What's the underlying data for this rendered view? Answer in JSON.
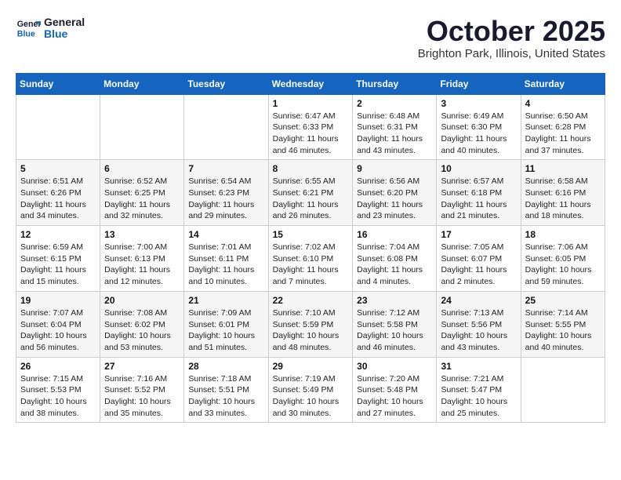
{
  "header": {
    "logo_line1": "General",
    "logo_line2": "Blue",
    "month": "October 2025",
    "location": "Brighton Park, Illinois, United States"
  },
  "weekdays": [
    "Sunday",
    "Monday",
    "Tuesday",
    "Wednesday",
    "Thursday",
    "Friday",
    "Saturday"
  ],
  "weeks": [
    [
      {
        "day": "",
        "info": ""
      },
      {
        "day": "",
        "info": ""
      },
      {
        "day": "",
        "info": ""
      },
      {
        "day": "1",
        "info": "Sunrise: 6:47 AM\nSunset: 6:33 PM\nDaylight: 11 hours\nand 46 minutes."
      },
      {
        "day": "2",
        "info": "Sunrise: 6:48 AM\nSunset: 6:31 PM\nDaylight: 11 hours\nand 43 minutes."
      },
      {
        "day": "3",
        "info": "Sunrise: 6:49 AM\nSunset: 6:30 PM\nDaylight: 11 hours\nand 40 minutes."
      },
      {
        "day": "4",
        "info": "Sunrise: 6:50 AM\nSunset: 6:28 PM\nDaylight: 11 hours\nand 37 minutes."
      }
    ],
    [
      {
        "day": "5",
        "info": "Sunrise: 6:51 AM\nSunset: 6:26 PM\nDaylight: 11 hours\nand 34 minutes."
      },
      {
        "day": "6",
        "info": "Sunrise: 6:52 AM\nSunset: 6:25 PM\nDaylight: 11 hours\nand 32 minutes."
      },
      {
        "day": "7",
        "info": "Sunrise: 6:54 AM\nSunset: 6:23 PM\nDaylight: 11 hours\nand 29 minutes."
      },
      {
        "day": "8",
        "info": "Sunrise: 6:55 AM\nSunset: 6:21 PM\nDaylight: 11 hours\nand 26 minutes."
      },
      {
        "day": "9",
        "info": "Sunrise: 6:56 AM\nSunset: 6:20 PM\nDaylight: 11 hours\nand 23 minutes."
      },
      {
        "day": "10",
        "info": "Sunrise: 6:57 AM\nSunset: 6:18 PM\nDaylight: 11 hours\nand 21 minutes."
      },
      {
        "day": "11",
        "info": "Sunrise: 6:58 AM\nSunset: 6:16 PM\nDaylight: 11 hours\nand 18 minutes."
      }
    ],
    [
      {
        "day": "12",
        "info": "Sunrise: 6:59 AM\nSunset: 6:15 PM\nDaylight: 11 hours\nand 15 minutes."
      },
      {
        "day": "13",
        "info": "Sunrise: 7:00 AM\nSunset: 6:13 PM\nDaylight: 11 hours\nand 12 minutes."
      },
      {
        "day": "14",
        "info": "Sunrise: 7:01 AM\nSunset: 6:11 PM\nDaylight: 11 hours\nand 10 minutes."
      },
      {
        "day": "15",
        "info": "Sunrise: 7:02 AM\nSunset: 6:10 PM\nDaylight: 11 hours\nand 7 minutes."
      },
      {
        "day": "16",
        "info": "Sunrise: 7:04 AM\nSunset: 6:08 PM\nDaylight: 11 hours\nand 4 minutes."
      },
      {
        "day": "17",
        "info": "Sunrise: 7:05 AM\nSunset: 6:07 PM\nDaylight: 11 hours\nand 2 minutes."
      },
      {
        "day": "18",
        "info": "Sunrise: 7:06 AM\nSunset: 6:05 PM\nDaylight: 10 hours\nand 59 minutes."
      }
    ],
    [
      {
        "day": "19",
        "info": "Sunrise: 7:07 AM\nSunset: 6:04 PM\nDaylight: 10 hours\nand 56 minutes."
      },
      {
        "day": "20",
        "info": "Sunrise: 7:08 AM\nSunset: 6:02 PM\nDaylight: 10 hours\nand 53 minutes."
      },
      {
        "day": "21",
        "info": "Sunrise: 7:09 AM\nSunset: 6:01 PM\nDaylight: 10 hours\nand 51 minutes."
      },
      {
        "day": "22",
        "info": "Sunrise: 7:10 AM\nSunset: 5:59 PM\nDaylight: 10 hours\nand 48 minutes."
      },
      {
        "day": "23",
        "info": "Sunrise: 7:12 AM\nSunset: 5:58 PM\nDaylight: 10 hours\nand 46 minutes."
      },
      {
        "day": "24",
        "info": "Sunrise: 7:13 AM\nSunset: 5:56 PM\nDaylight: 10 hours\nand 43 minutes."
      },
      {
        "day": "25",
        "info": "Sunrise: 7:14 AM\nSunset: 5:55 PM\nDaylight: 10 hours\nand 40 minutes."
      }
    ],
    [
      {
        "day": "26",
        "info": "Sunrise: 7:15 AM\nSunset: 5:53 PM\nDaylight: 10 hours\nand 38 minutes."
      },
      {
        "day": "27",
        "info": "Sunrise: 7:16 AM\nSunset: 5:52 PM\nDaylight: 10 hours\nand 35 minutes."
      },
      {
        "day": "28",
        "info": "Sunrise: 7:18 AM\nSunset: 5:51 PM\nDaylight: 10 hours\nand 33 minutes."
      },
      {
        "day": "29",
        "info": "Sunrise: 7:19 AM\nSunset: 5:49 PM\nDaylight: 10 hours\nand 30 minutes."
      },
      {
        "day": "30",
        "info": "Sunrise: 7:20 AM\nSunset: 5:48 PM\nDaylight: 10 hours\nand 27 minutes."
      },
      {
        "day": "31",
        "info": "Sunrise: 7:21 AM\nSunset: 5:47 PM\nDaylight: 10 hours\nand 25 minutes."
      },
      {
        "day": "",
        "info": ""
      }
    ]
  ]
}
